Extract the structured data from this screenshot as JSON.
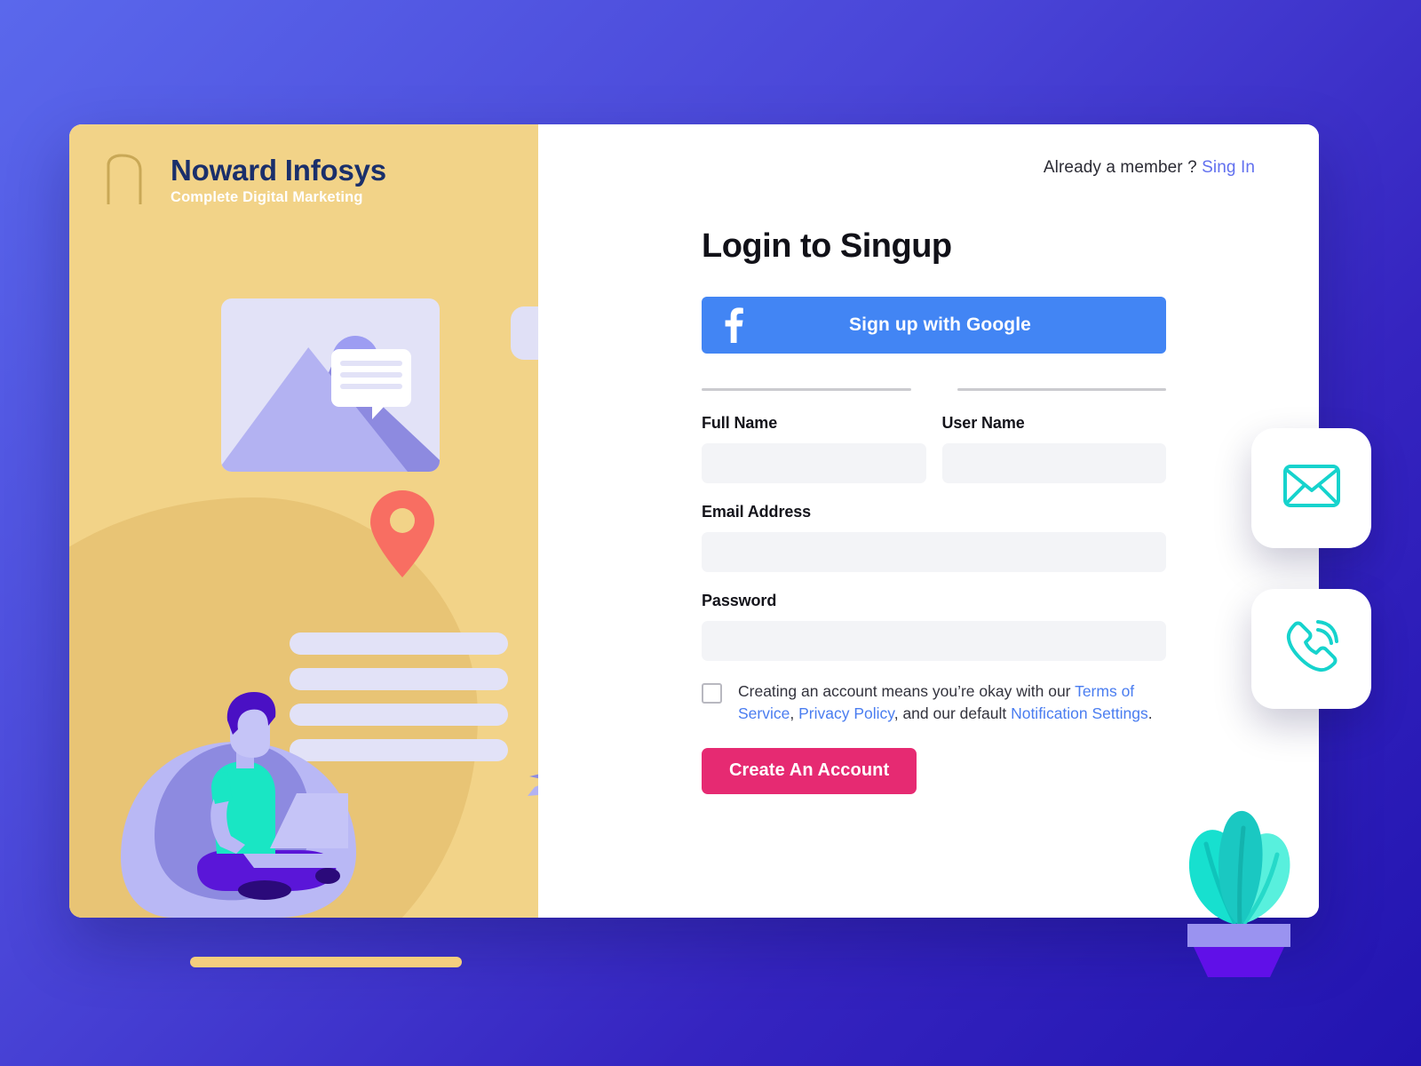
{
  "brand": {
    "mark_letter": "n",
    "title": "Noward Infosys",
    "subtitle": "Complete Digital Marketing"
  },
  "header": {
    "member_prompt": "Already a member ?",
    "signin_label": "Sing In"
  },
  "form": {
    "title": "Login to Singup",
    "social_button": {
      "label": "Sign up with Google",
      "icon": "facebook-f-icon",
      "color": "#4285f4"
    },
    "fields": [
      {
        "key": "full_name",
        "label": "Full Name",
        "value": "",
        "placeholder": ""
      },
      {
        "key": "user_name",
        "label": "User Name",
        "value": "",
        "placeholder": ""
      },
      {
        "key": "email",
        "label": "Email Address",
        "value": "",
        "placeholder": ""
      },
      {
        "key": "password",
        "label": "Password",
        "value": "",
        "placeholder": ""
      }
    ],
    "terms": {
      "checked": false,
      "part1": "Creating an account means you’re okay with our ",
      "link1": "Terms of Service",
      "part2": ", ",
      "link2": "Privacy Policy",
      "part3": ", and our default ",
      "link3": "Notification Settings",
      "part4": "."
    },
    "submit_label": "Create An Account"
  },
  "illustration": {
    "image_card": "image-placeholder",
    "play_card": "play-button",
    "location_pin": "location-pin-icon",
    "text_bars": 4,
    "person": "person-with-laptop",
    "paper_plane": "paper-plane-icon"
  },
  "floating_cards": [
    {
      "name": "mail-icon",
      "icon": "envelope"
    },
    {
      "name": "phone-icon",
      "icon": "phone-call"
    }
  ],
  "decor": {
    "plant": "potted-plant",
    "bottom_bar": "yellow-accent-bar"
  },
  "colors": {
    "bg_start": "#5a68ec",
    "bg_end": "#2214b0",
    "panel_yellow": "#f2d388",
    "brand_navy": "#1a2f6b",
    "social_blue": "#4285f4",
    "cta_pink": "#e62a72",
    "link_blue": "#4a7df0",
    "signin_blue": "#6170ef",
    "icon_teal": "#16d3cd",
    "pin_coral": "#f86e62",
    "lavender": "#e2e2f7"
  }
}
